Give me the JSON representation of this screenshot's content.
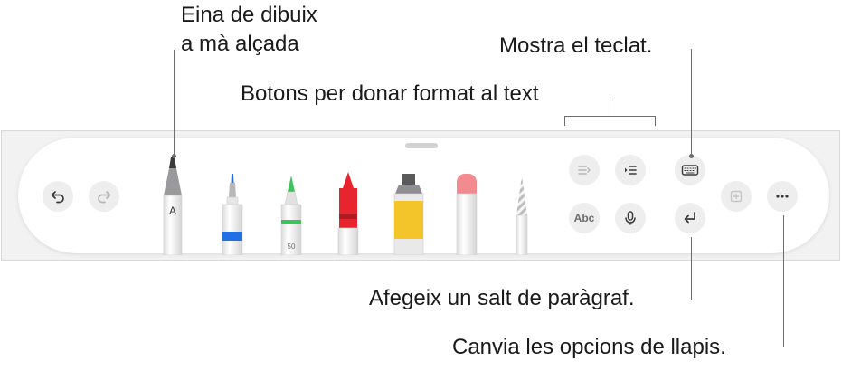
{
  "callouts": {
    "handwriting_line1": "Eina de dibuix",
    "handwriting_line2": "a mà alçada",
    "keyboard": "Mostra el teclat.",
    "formatting": "Botons per donar format al text",
    "paragraph": "Afegeix un salt de paràgraf.",
    "options": "Canvia les opcions de llapis."
  },
  "tools": {
    "handwriting_letter": "A",
    "pencil_size": "50",
    "text_style_label": "Abc"
  },
  "colors": {
    "pen_accent": "#1f6fe5",
    "marker_accent": "#3fc25b",
    "crayon": "#e8242e",
    "paint": "#f3c52a",
    "eraser_cap": "#f28b90",
    "icon_gray": "#8e8e93"
  }
}
